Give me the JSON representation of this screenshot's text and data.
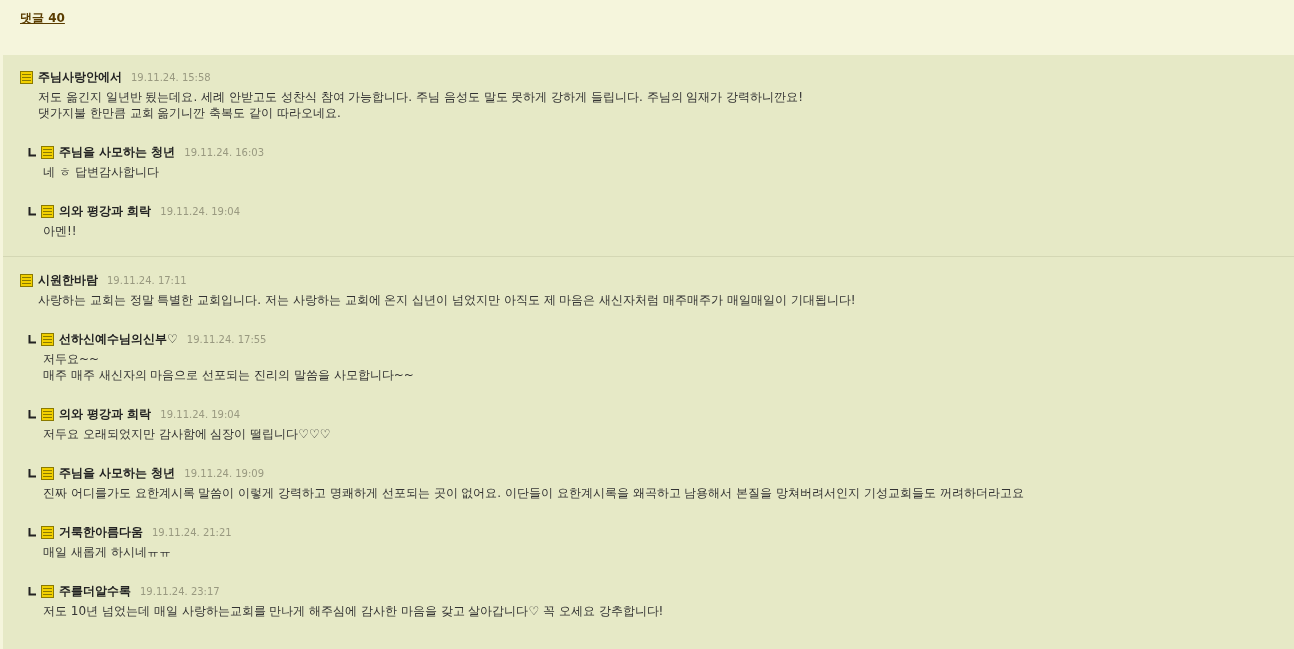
{
  "comment_count_link": "댓글 40",
  "threads": [
    {
      "author": "주님사랑안에서",
      "time": "19.11.24. 15:58",
      "lines": [
        "저도 옮긴지 일년반 됬는데요. 세례 안받고도 성찬식 참여 가능합니다. 주님 음성도 말도 못하게 강하게 들립니다. 주님의 임재가 강력하니깐요!",
        "댓가지불 한만큼 교회 옮기니깐 축복도 같이 따라오네요."
      ],
      "children": [
        {
          "author": "주님을 사모하는 청년",
          "time": "19.11.24. 16:03",
          "lines": [
            "네 ㅎ 답변감사합니다"
          ]
        },
        {
          "author": "의와 평강과 희락",
          "time": "19.11.24. 19:04",
          "lines": [
            "아멘!!"
          ]
        }
      ]
    },
    {
      "author": "시원한바람",
      "time": "19.11.24. 17:11",
      "lines": [
        "사랑하는 교회는 정말 특별한 교회입니다. 저는 사랑하는 교회에 온지 십년이 넘었지만 아직도 제 마음은 새신자처럼 매주매주가 매일매일이 기대됩니다!"
      ],
      "children": [
        {
          "author": "선하신예수님의신부♡",
          "time": "19.11.24. 17:55",
          "lines": [
            "저두요~~",
            "매주 매주 새신자의 마음으로 선포되는 진리의 말씀을 사모합니다~~"
          ]
        },
        {
          "author": "의와 평강과 희락",
          "time": "19.11.24. 19:04",
          "lines": [
            "저두요 오래되었지만 감사함에 심장이 떨립니다♡♡♡"
          ]
        },
        {
          "author": "주님을 사모하는 청년",
          "time": "19.11.24. 19:09",
          "lines": [
            "진짜 어디를가도 요한계시록 말씀이 이렇게 강력하고 명쾌하게 선포되는 곳이 없어요. 이단들이 요한계시록을 왜곡하고 남용해서 본질을 망쳐버려서인지 기성교회들도 꺼려하더라고요"
          ]
        },
        {
          "author": "거룩한아름다움",
          "time": "19.11.24. 21:21",
          "lines": [
            "매일 새롭게 하시네ㅠㅠ"
          ]
        },
        {
          "author": "주를더알수록",
          "time": "19.11.24. 23:17",
          "lines": [
            "저도 10년 넘었는데 매일 사랑하는교회를 만나게 해주심에 감사한 마음을 갖고 살아갑니다♡ 꼭 오세요 강추합니다!"
          ]
        }
      ]
    }
  ]
}
